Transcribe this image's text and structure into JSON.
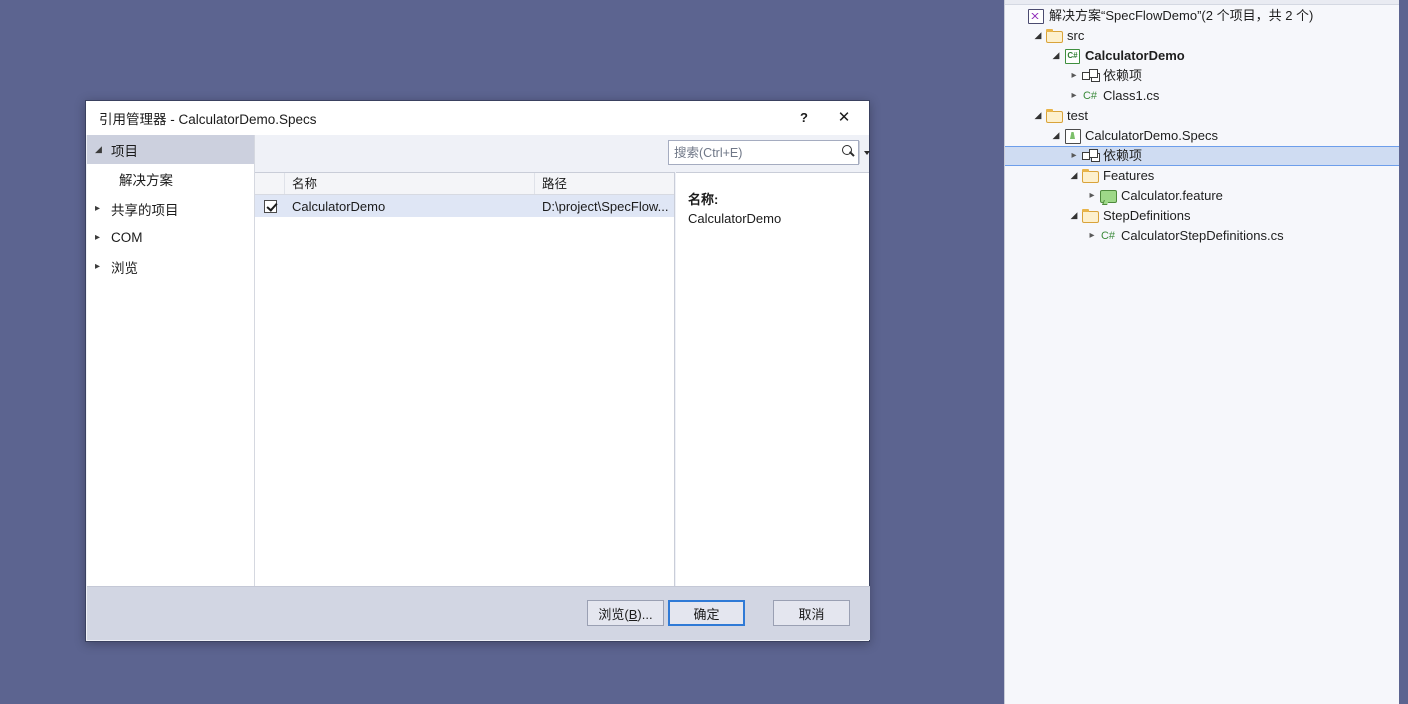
{
  "dialog": {
    "title": "引用管理器 - CalculatorDemo.Specs",
    "help_label": "?",
    "close_label": "✕",
    "nav": {
      "items": [
        {
          "label": "项目",
          "state": "expanded",
          "active": true
        },
        {
          "label": "共享的项目",
          "state": "collapsed",
          "active": false
        },
        {
          "label": "COM",
          "state": "collapsed",
          "active": false
        },
        {
          "label": "浏览",
          "state": "collapsed",
          "active": false
        }
      ],
      "sub_item": "解决方案"
    },
    "search": {
      "placeholder": "搜索(Ctrl+E)",
      "value": "",
      "icon": "search-icon",
      "dropdown_icon": "chevron-down-icon"
    },
    "list": {
      "columns": [
        "",
        "名称",
        "路径"
      ],
      "rows": [
        {
          "checked": true,
          "name": "CalculatorDemo",
          "path": "D:\\project\\SpecFlow..."
        }
      ]
    },
    "details": {
      "name_label": "名称:",
      "name_value": "CalculatorDemo"
    },
    "buttons": {
      "browse": "浏览(B)...",
      "browse_pre": "浏览(",
      "browse_key": "B",
      "browse_post": ")...",
      "ok": "确定",
      "cancel": "取消"
    }
  },
  "solution_explorer": {
    "tree": [
      {
        "label": "解决方案“SpecFlowDemo”(2 个项目，共 2 个)",
        "indent": 0,
        "expander": "none",
        "icon": "solution-icon",
        "bold": false,
        "selected": false
      },
      {
        "label": "src",
        "indent": 1,
        "expander": "expanded",
        "icon": "folder-icon",
        "bold": false,
        "selected": false
      },
      {
        "label": "CalculatorDemo",
        "indent": 2,
        "expander": "expanded",
        "icon": "csharp-project-icon",
        "bold": true,
        "selected": false
      },
      {
        "label": "依赖项",
        "indent": 3,
        "expander": "collapsed",
        "icon": "dependencies-icon",
        "bold": false,
        "selected": false
      },
      {
        "label": "Class1.cs",
        "indent": 3,
        "expander": "collapsed",
        "icon": "csharp-file-icon",
        "bold": false,
        "selected": false
      },
      {
        "label": "test",
        "indent": 1,
        "expander": "expanded",
        "icon": "folder-icon",
        "bold": false,
        "selected": false
      },
      {
        "label": "CalculatorDemo.Specs",
        "indent": 2,
        "expander": "expanded",
        "icon": "test-project-icon",
        "bold": false,
        "selected": false
      },
      {
        "label": "依赖项",
        "indent": 3,
        "expander": "collapsed",
        "icon": "dependencies-icon",
        "bold": false,
        "selected": true
      },
      {
        "label": "Features",
        "indent": 3,
        "expander": "expanded",
        "icon": "folder-icon",
        "bold": false,
        "selected": false
      },
      {
        "label": "Calculator.feature",
        "indent": 4,
        "expander": "collapsed",
        "icon": "feature-file-icon",
        "bold": false,
        "selected": false
      },
      {
        "label": "StepDefinitions",
        "indent": 3,
        "expander": "expanded",
        "icon": "folder-icon",
        "bold": false,
        "selected": false
      },
      {
        "label": "CalculatorStepDefinitions.cs",
        "indent": 4,
        "expander": "collapsed",
        "icon": "csharp-file-icon",
        "bold": false,
        "selected": false
      }
    ]
  },
  "colors": {
    "desktop": "#5c6490",
    "dialog_body": "#eff1f7",
    "footer": "#d2d6e3",
    "selection": "#cfdcf2",
    "selection_border": "#6d9eeb",
    "row_selection": "#dfe6f5",
    "nav_active": "#ccd0de",
    "default_button_border": "#2f7ad6"
  }
}
